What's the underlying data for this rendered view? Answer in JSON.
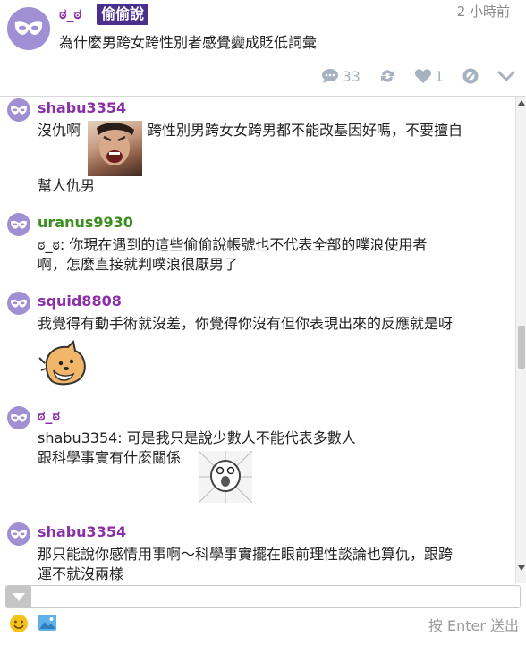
{
  "post": {
    "author": "ಠ_ಠ",
    "qualifier": "偷偷說",
    "time": "2 小時前",
    "content": "為什麼男跨女跨性別者感覺變成貶低詞彙",
    "response_count": "33",
    "like_count": "1"
  },
  "responses": [
    {
      "author": "shabu3354",
      "name_color": "#8b2fa8",
      "line1_before": "沒仇啊",
      "line1_after": "跨性別男跨女女跨男都不能改基因好嗎，不要擅自",
      "line2": "幫人仇男"
    },
    {
      "author": "uranus9930",
      "name_color": "#3a8d1e",
      "line1": "ಠ_ಠ: 你現在遇到的這些偷偷說帳號也不代表全部的噗浪使用者",
      "line2": "啊，怎麼直接就判噗浪很厭男了"
    },
    {
      "author": "squid8808",
      "name_color": "#8b2fa8",
      "line1": "我覺得有動手術就沒差，你覺得你沒有但你表現出來的反應就是呀"
    },
    {
      "author": "ಠ_ಠ",
      "name_color": "#8b2fa8",
      "line1": "shabu3354: 可是我只是說少數人不能代表多數人",
      "line2": "跟科學事實有什麼關係"
    },
    {
      "author": "shabu3354",
      "name_color": "#8b2fa8",
      "line1": "那只能說你感情用事啊～科學事實擺在眼前理性談論也算仇，跟跨",
      "line2": "運不就沒兩樣"
    }
  ],
  "input": {
    "send_hint": "按 Enter 送出"
  },
  "icons": {
    "avatar": "mask-icon",
    "responses": "speech-bubble-icon",
    "replurk": "replurk-icon",
    "like": "heart-icon",
    "mute": "mute-icon",
    "more": "chevron-down-icon",
    "emoticon": "smiley-icon",
    "image": "image-icon"
  },
  "colors": {
    "avatar_bg": "#a18fd3",
    "qualifier_bg": "#4b2f8c",
    "action_icons": "#a6b2bf"
  }
}
